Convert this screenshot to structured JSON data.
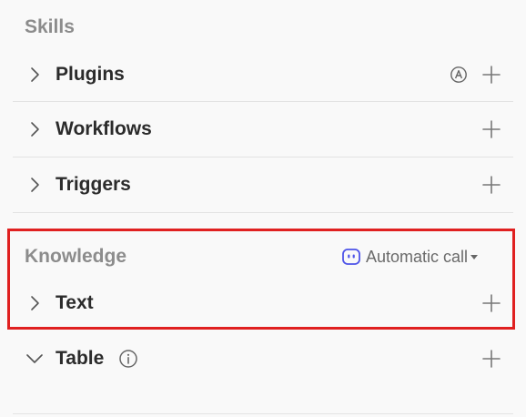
{
  "skills": {
    "title": "Skills",
    "items": [
      {
        "label": "Plugins",
        "icons": [
          "chevron-right-icon",
          "auto-icon",
          "plus-icon"
        ]
      },
      {
        "label": "Workflows",
        "icons": [
          "chevron-right-icon",
          "plus-icon"
        ]
      },
      {
        "label": "Triggers",
        "icons": [
          "chevron-right-icon",
          "plus-icon"
        ]
      }
    ]
  },
  "knowledge": {
    "title": "Knowledge",
    "call_mode": {
      "label": "Automatic call",
      "icon": "bot-icon",
      "accent": "#4d53e8"
    },
    "items": [
      {
        "label": "Text",
        "expanded": false,
        "icons": [
          "chevron-right-icon",
          "plus-icon"
        ]
      },
      {
        "label": "Table",
        "expanded": true,
        "icons": [
          "chevron-down-icon",
          "info-icon",
          "plus-icon"
        ]
      }
    ]
  },
  "colors": {
    "highlight": "#e02020",
    "background": "#f9f9f9"
  }
}
